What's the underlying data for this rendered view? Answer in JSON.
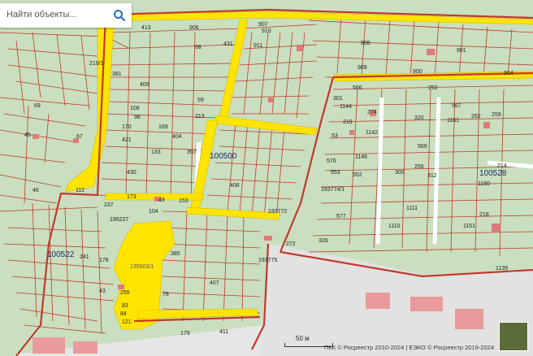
{
  "search": {
    "placeholder": "Найти объекты..."
  },
  "attribution": "ПКК © Росреестр 2010-2024 | ЕЭКО © Росреестр 2019-2024",
  "scale_label": "50 м",
  "icons": {
    "search": "search-icon",
    "minimap": "layers-minimap-icon"
  },
  "colors": {
    "parcel_fill": "#c9dfbf",
    "boundary": "#c0392b",
    "highlight": "#ffe400",
    "background": "#e6e6e6"
  },
  "labels": {
    "q100500": "100500",
    "q100528": "100528",
    "q100522": "100522",
    "p193772": "193772",
    "p193774": "193774/1",
    "p193775": "193775",
    "p135503": "135503/1",
    "p195227": "195227",
    "n906": "906",
    "n907": "907",
    "n910": "910",
    "n911": "911",
    "n409": "409",
    "n431": "431",
    "n68": "68",
    "n59": "59",
    "n213": "213",
    "n357": "357",
    "n430": "430",
    "n421": "421",
    "n133": "133",
    "n404": "404",
    "n170": "170",
    "n169": "169",
    "n108": "108",
    "n98": "98",
    "n406": "406",
    "n112": "112",
    "n173": "173",
    "n153": "153",
    "n49": "49",
    "n407": "407",
    "n411": "411",
    "n121": "121",
    "n385": "385",
    "n255": "255",
    "n179": "179",
    "n566": "566",
    "n252": "252",
    "n567": "567",
    "n569": "569",
    "n1146": "1146",
    "n1150": "1150",
    "n1151": "1151",
    "n218": "218",
    "n1110": "1110",
    "n1111": "1111",
    "n312": "312",
    "n300": "300",
    "n553": "553",
    "n552": "552",
    "n577": "577",
    "n328": "328",
    "n272": "272",
    "n69": "69",
    "n46": "46",
    "n45": "45",
    "n67": "67",
    "n413": "413",
    "n904": "904",
    "n901": "901",
    "n900": "900",
    "n908": "908",
    "n909": "909",
    "n1144": "1144",
    "n274": "274",
    "n320": "320",
    "n256": "256",
    "n259": "259",
    "n214": "214",
    "n1139": "1139",
    "n43": "43",
    "n83": "83",
    "n78": "78",
    "n84": "84",
    "n237": "237",
    "n241": "241",
    "n176": "176",
    "n104": "104",
    "n301": "301",
    "n219": "219",
    "n53": "53",
    "n576": "576",
    "n1142": "1142",
    "n1161": "1161",
    "n262": "262",
    "n381": "381",
    "n219_1": "219/1"
  }
}
